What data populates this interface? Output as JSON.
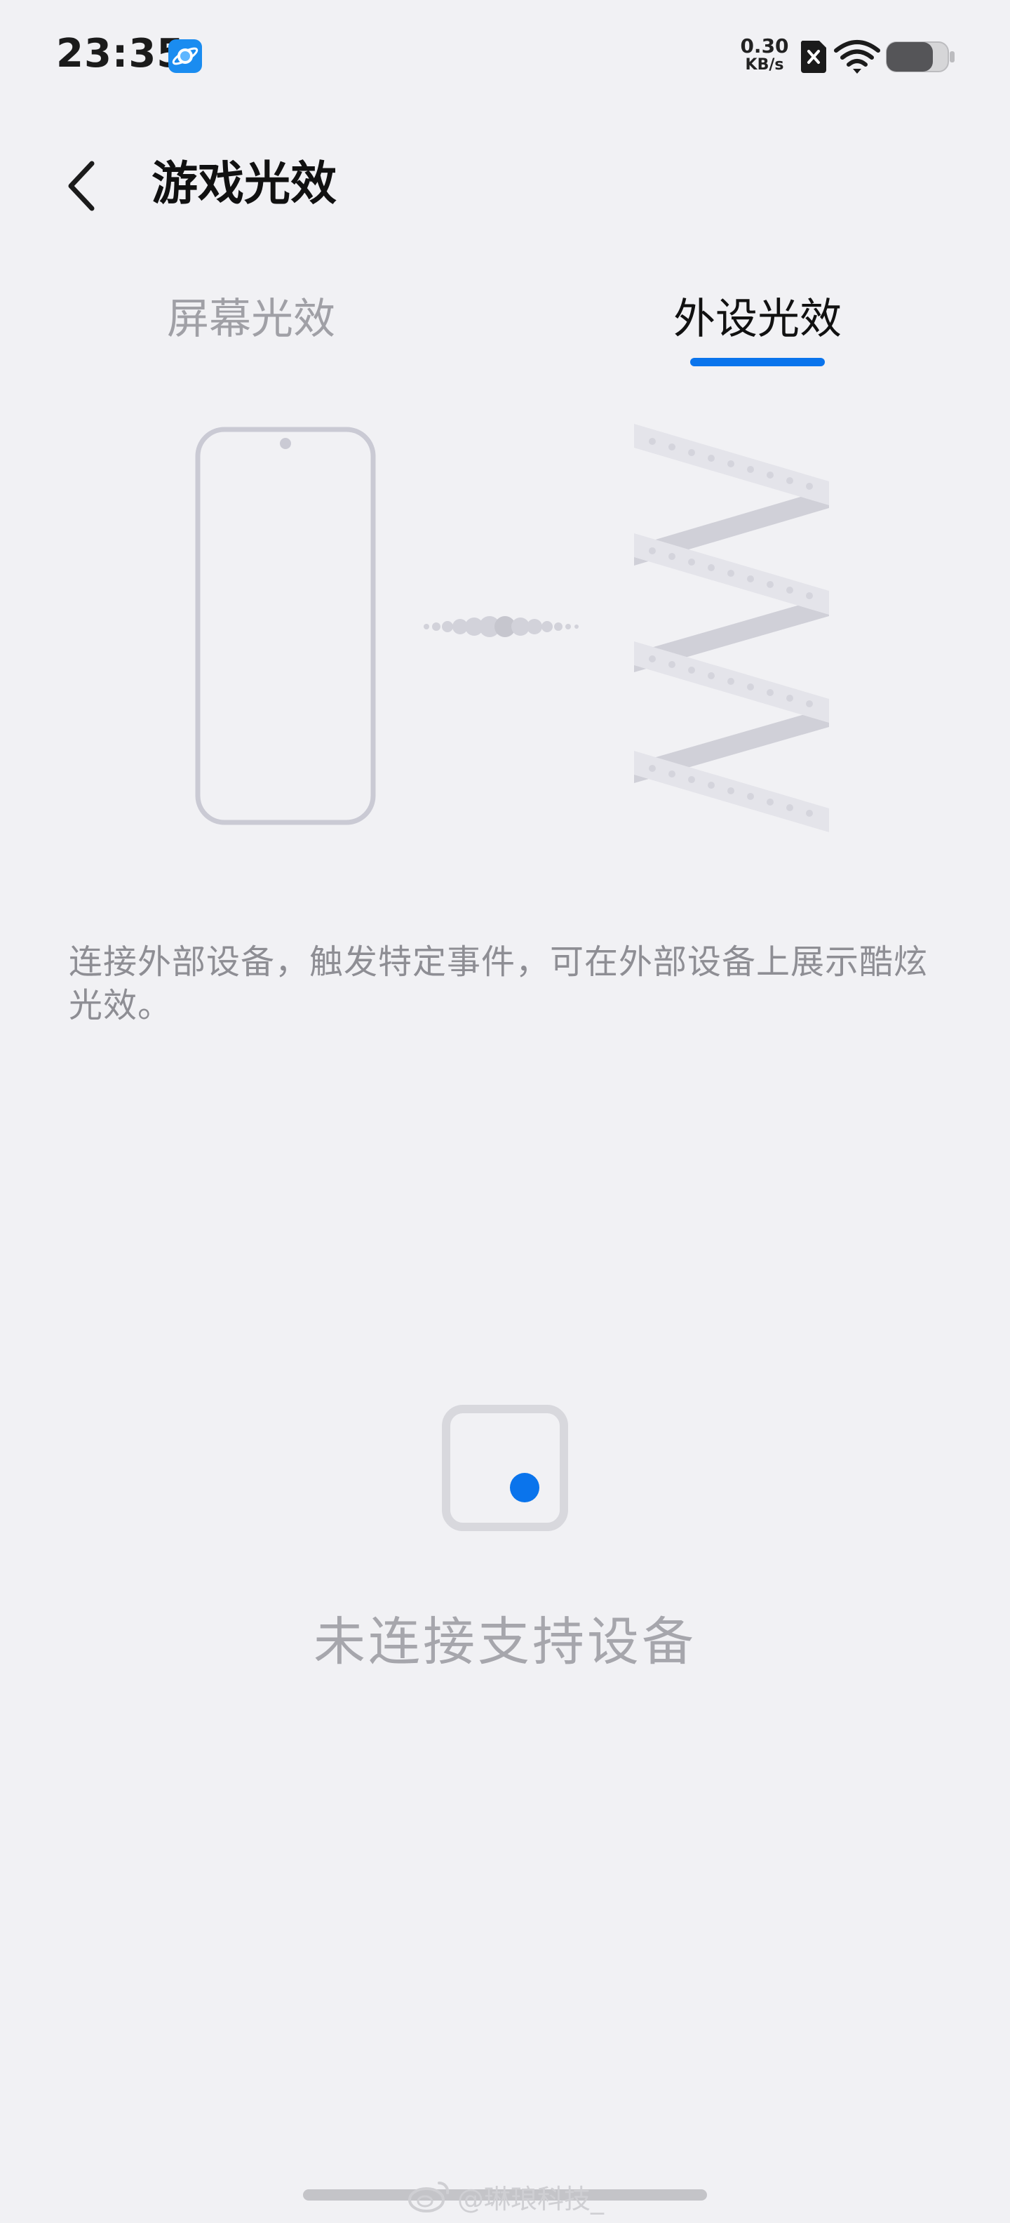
{
  "status_bar": {
    "time": "23:35",
    "net_speed_value": "0.30",
    "net_speed_unit": "KB/s",
    "app_icon": "planet-app-icon",
    "sim_icon": "no-sim-icon",
    "wifi_icon": "wifi-icon",
    "battery_icon": "battery-icon"
  },
  "header": {
    "back_icon": "chevron-left-icon",
    "title": "游戏光效"
  },
  "tabs": [
    {
      "label": "屏幕光效",
      "selected": false
    },
    {
      "label": "外设光效",
      "selected": true
    }
  ],
  "description": "连接外部设备，触发特定事件，可在外部设备上展示酷炫光效。",
  "empty_state": {
    "icon": "device-placeholder-icon",
    "text": "未连接支持设备"
  },
  "watermark": {
    "icon": "weibo-icon",
    "text": "@琳琅科技_"
  },
  "colors": {
    "background": "#f1f1f4",
    "accent": "#0a74ec",
    "tab_inactive": "#a0a0a6",
    "description_text": "#8e8e94",
    "empty_text": "#a6a6ac"
  }
}
